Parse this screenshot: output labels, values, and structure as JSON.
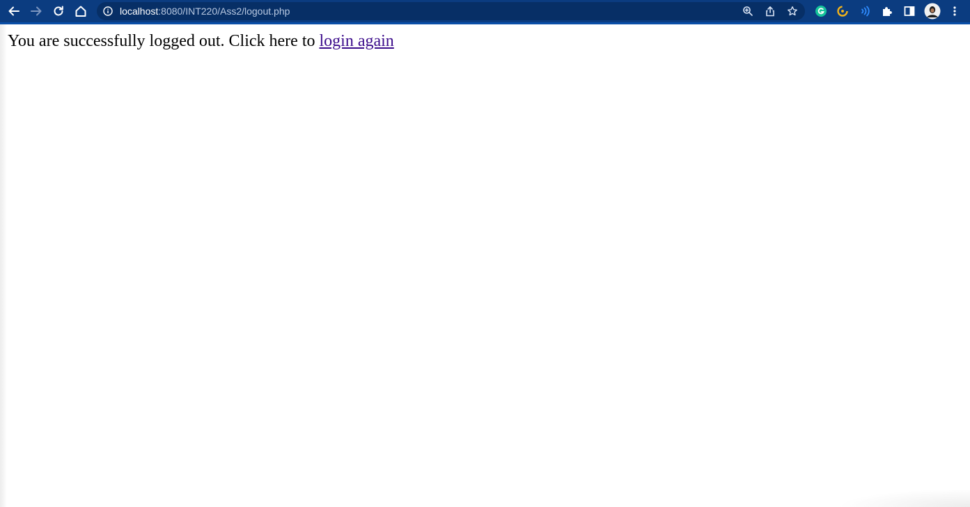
{
  "browser": {
    "url_host": "localhost",
    "url_rest": ":8080/INT220/Ass2/logout.php",
    "toolbar_color": "#0b3c80",
    "icons": [
      "back-arrow-icon",
      "forward-arrow-icon",
      "reload-icon",
      "home-icon",
      "info-icon",
      "zoom-icon",
      "share-icon",
      "bookmark-star-icon",
      "grammarly-extension-icon",
      "yellow-extension-icon",
      "wave-extension-icon",
      "extensions-puzzle-icon",
      "side-panel-icon",
      "profile-avatar",
      "more-menu-icon"
    ]
  },
  "page": {
    "message": "You are successfully logged out. Click here to ",
    "link_text": "login again",
    "link_color": "#3a0a8a"
  }
}
